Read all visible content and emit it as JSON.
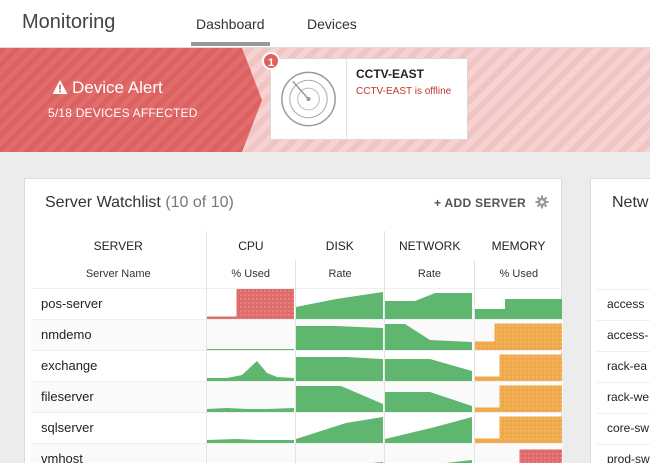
{
  "header": {
    "app_title": "Monitoring",
    "tabs": [
      {
        "label": "Dashboard",
        "active": true
      },
      {
        "label": "Devices",
        "active": false
      }
    ]
  },
  "alert": {
    "title": "Device Alert",
    "subtitle": "5/18 DEVICES AFFECTED",
    "badge_count": "1",
    "device": {
      "name": "CCTV-EAST",
      "status": "CCTV-EAST is offline"
    },
    "colors": {
      "alert": "#e06b6b",
      "status_text": "#c0392b"
    }
  },
  "watchlist": {
    "title": "Server Watchlist",
    "count": "(10 of 10)",
    "add_label": "ADD SERVER",
    "columns": [
      "SERVER",
      "CPU",
      "DISK",
      "NETWORK",
      "MEMORY"
    ],
    "subcolumns": [
      "Server Name",
      "% Used",
      "Rate",
      "Rate",
      "% Used"
    ],
    "rows": [
      {
        "name": "pos-server"
      },
      {
        "name": "nmdemo"
      },
      {
        "name": "exchange"
      },
      {
        "name": "fileserver"
      },
      {
        "name": "sqlserver"
      },
      {
        "name": "vmhost"
      }
    ],
    "colors": {
      "ok": "#5fb66e",
      "critical": "#e06b6b",
      "warning": "#f0a94a"
    }
  },
  "network_panel": {
    "title": "Netw",
    "rows": [
      "access",
      "access-",
      "rack-ea",
      "rack-we",
      "core-sw",
      "prod-sw"
    ]
  }
}
